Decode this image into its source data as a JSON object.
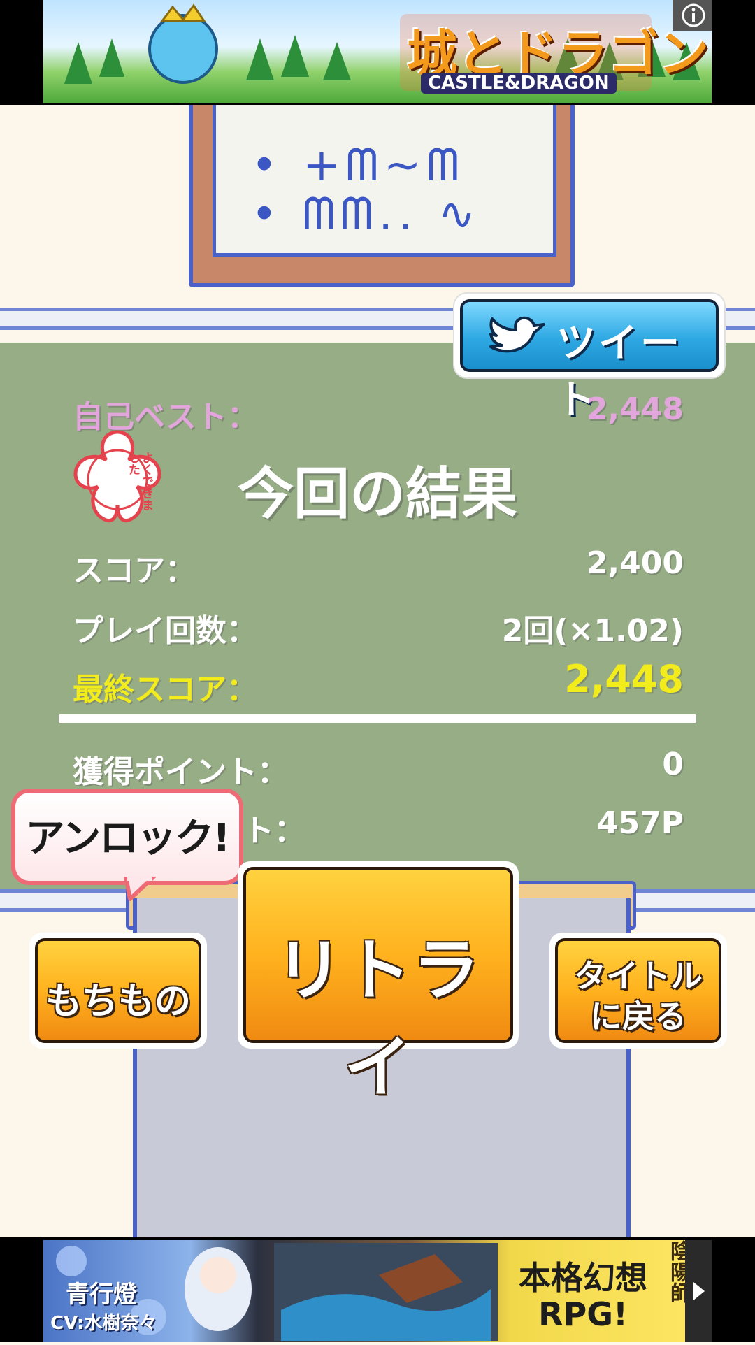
{
  "ads": {
    "top": {
      "brand_jp": "城とドラゴン",
      "brand_en": "CASTLE&DRAGON",
      "info_icon": "info-icon"
    },
    "bottom": {
      "character_name": "青行燈",
      "voice_actor": "CV:水樹奈々",
      "tagline": "本格幻想 RPG!",
      "logo_text": "陰陽師",
      "next_icon": "play-triangle-icon"
    }
  },
  "tweet_button": {
    "label": "ツイート",
    "icon": "twitter-bird-icon"
  },
  "results": {
    "best_label": "自己ベスト：",
    "best_value": "2,448",
    "title": "今回の結果",
    "score_label": "スコア：",
    "score_value": "2,400",
    "plays_label": "プレイ回数：",
    "plays_value": "2回(×1.02)",
    "final_label": "最終スコア：",
    "final_value": "2,448",
    "earned_label": "獲得ポイント：",
    "earned_value": "0",
    "total_label_visible": "ト：",
    "total_value": "457P",
    "stamp_text": "よくできました"
  },
  "unlock_bubble": {
    "label": "アンロック!"
  },
  "buttons": {
    "items": "もちもの",
    "retry": "リトライ",
    "title_line1": "タイトル",
    "title_line2": "に戻る"
  },
  "colors": {
    "panel": "#96ad86",
    "best": "#e3a6dc",
    "final": "#f3ec1d",
    "button": "#ffb21e",
    "tweet": "#2ea8e3"
  }
}
